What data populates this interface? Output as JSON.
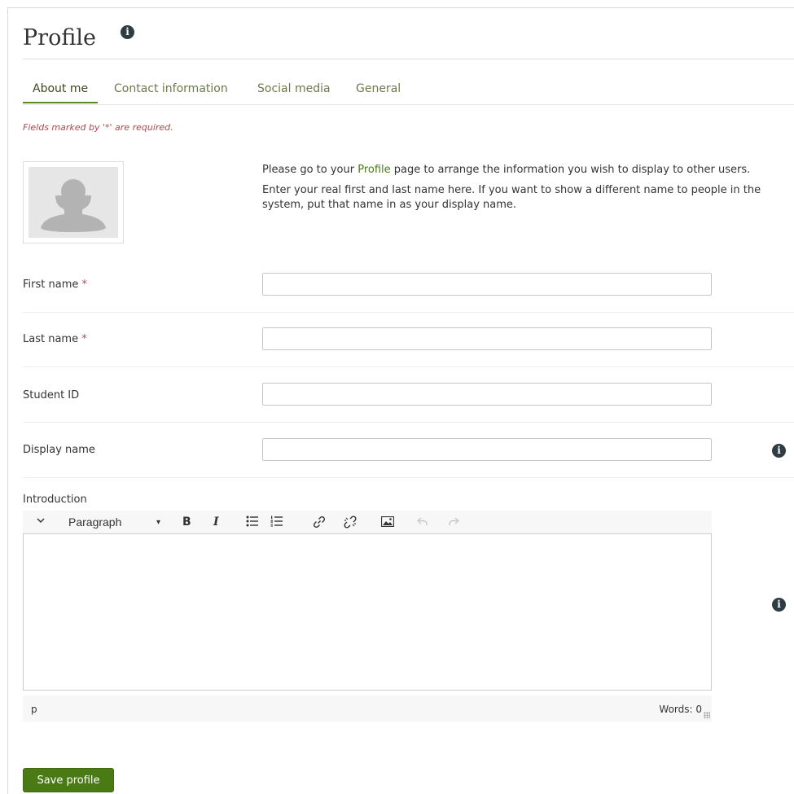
{
  "page": {
    "title": "Profile",
    "info_icon": "info-icon"
  },
  "tabs": [
    {
      "label": "About me",
      "active": true
    },
    {
      "label": "Contact information",
      "active": false
    },
    {
      "label": "Social media",
      "active": false
    },
    {
      "label": "General",
      "active": false
    }
  ],
  "required_note": "Fields marked by '*' are required.",
  "intro": {
    "p1_before": "Please go to your ",
    "p1_link": "Profile",
    "p1_after": " page to arrange the information you wish to display to other users.",
    "p2": "Enter your real first and last name here. If you want to show a different name to people in the system, put that name in as your display name."
  },
  "avatar": {
    "icon": "default-user-avatar"
  },
  "fields": {
    "first_name": {
      "label": "First name",
      "required_mark": "*",
      "value": ""
    },
    "last_name": {
      "label": "Last name",
      "required_mark": "*",
      "value": ""
    },
    "student_id": {
      "label": "Student ID",
      "value": ""
    },
    "display_name": {
      "label": "Display name",
      "value": ""
    }
  },
  "introduction": {
    "label": "Introduction",
    "toolbar": {
      "format_select": "Paragraph",
      "bold": "B",
      "italic": "I",
      "icons": [
        "chevron-down-icon",
        "bold-icon",
        "italic-icon",
        "bullet-list-icon",
        "numbered-list-icon",
        "link-icon",
        "unlink-icon",
        "image-icon",
        "undo-icon",
        "redo-icon"
      ]
    },
    "status_path": "p",
    "word_count": "Words: 0"
  },
  "save_button": {
    "label": "Save profile"
  },
  "colors": {
    "accent": "#4a7a14",
    "tab_text": "#6b7a4a",
    "required": "#b5474e",
    "info_icon": "#2e3d44"
  }
}
